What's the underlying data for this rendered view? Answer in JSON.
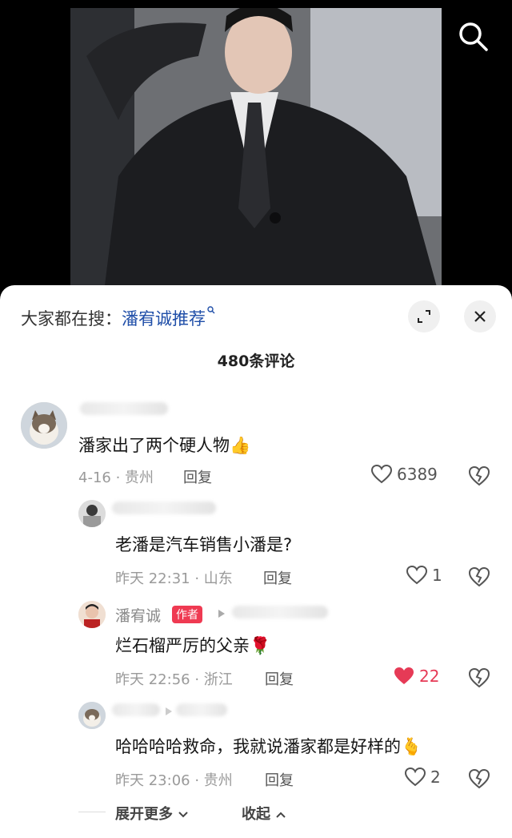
{
  "header": {
    "search_prefix": "大家都在搜：",
    "hot_search": "潘宥诚推荐"
  },
  "comments_count": "480条评论",
  "comments": [
    {
      "text": "潘家出了两个硬人物",
      "emoji": "👍",
      "meta": "4-16 · 贵州",
      "reply_label": "回复",
      "likes": "6389"
    }
  ],
  "replies": [
    {
      "text": "老潘是汽车销售小潘是?",
      "meta": "昨天 22:31 · 山东",
      "reply_label": "回复",
      "likes": "1"
    },
    {
      "author_name": "潘宥诚",
      "author_tag": "作者",
      "text": "烂石榴严厉的父亲",
      "emoji": "🌹",
      "meta": "昨天 22:56 · 浙江",
      "reply_label": "回复",
      "likes": "22"
    },
    {
      "reply_to": "潘宥诚",
      "text": "哈哈哈哈救命，我就说潘家都是好样的",
      "emoji": "🫰",
      "meta": "昨天 23:06 · 贵州",
      "reply_label": "回复",
      "likes": "2"
    }
  ],
  "footer": {
    "expand_label": "展开更多",
    "collapse_label": "收起"
  },
  "colors": {
    "accent_blue": "#1f4ea8",
    "author_tag": "#ef3a52",
    "liked_heart": "#e63a56"
  }
}
